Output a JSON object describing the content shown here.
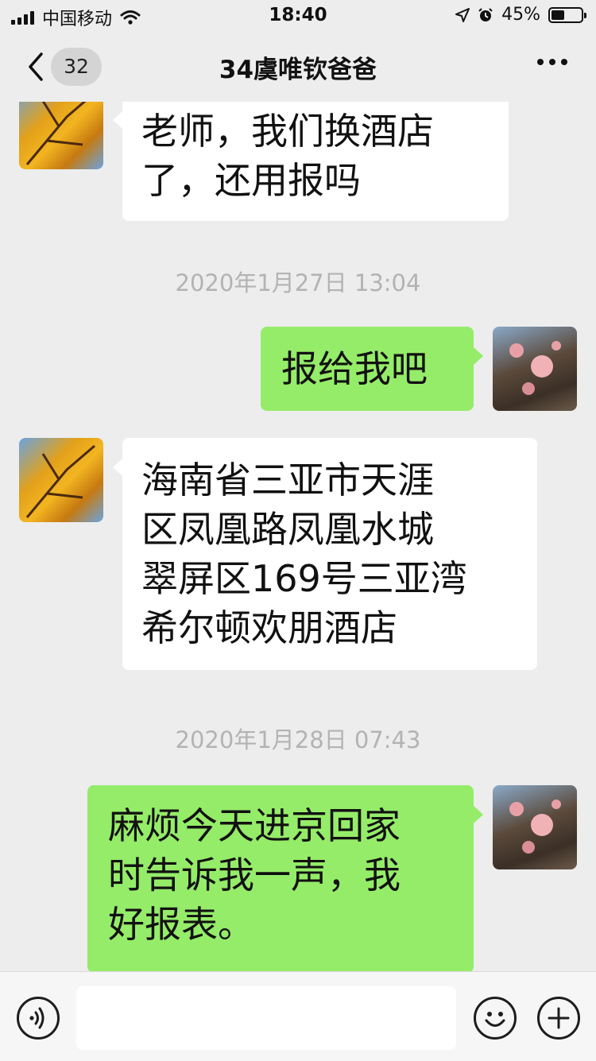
{
  "status_bar": {
    "carrier": "中国移动",
    "time": "18:40",
    "battery_percent": "45%",
    "battery_level": 0.45,
    "icons": [
      "signal-icon",
      "wifi-icon",
      "location-icon",
      "alarm-icon",
      "battery-icon"
    ]
  },
  "nav": {
    "back_count": "32",
    "title": "34虞唯钦爸爸",
    "icons": [
      "back-chevron-icon",
      "more-dots-icon"
    ]
  },
  "messages": [
    {
      "side": "left",
      "avatar": "ginkgo-tree-avatar",
      "lines": [
        "老师，我们换酒店",
        "了，还用报吗"
      ]
    },
    {
      "timestamp": "2020年1月27日 13:04"
    },
    {
      "side": "right",
      "avatar": "peach-blossom-avatar",
      "lines": [
        "报给我吧"
      ]
    },
    {
      "side": "left",
      "avatar": "ginkgo-tree-avatar",
      "lines": [
        "海南省三亚市天涯",
        "区凤凰路凤凰水城",
        "翠屏区169号三亚湾",
        "希尔顿欢朋酒店"
      ]
    },
    {
      "timestamp": "2020年1月28日 07:43"
    },
    {
      "side": "right",
      "avatar": "peach-blossom-avatar",
      "lines": [
        "麻烦今天进京回家",
        "时告诉我一声，我",
        "好报表。"
      ]
    }
  ],
  "input_bar": {
    "placeholder": "",
    "icons": [
      "voice-icon",
      "emoji-icon",
      "plus-icon"
    ]
  },
  "colors": {
    "background": "#ededed",
    "incoming_bubble": "#ffffff",
    "outgoing_bubble": "#95ec69",
    "timestamp_text": "#b3b3b3"
  }
}
